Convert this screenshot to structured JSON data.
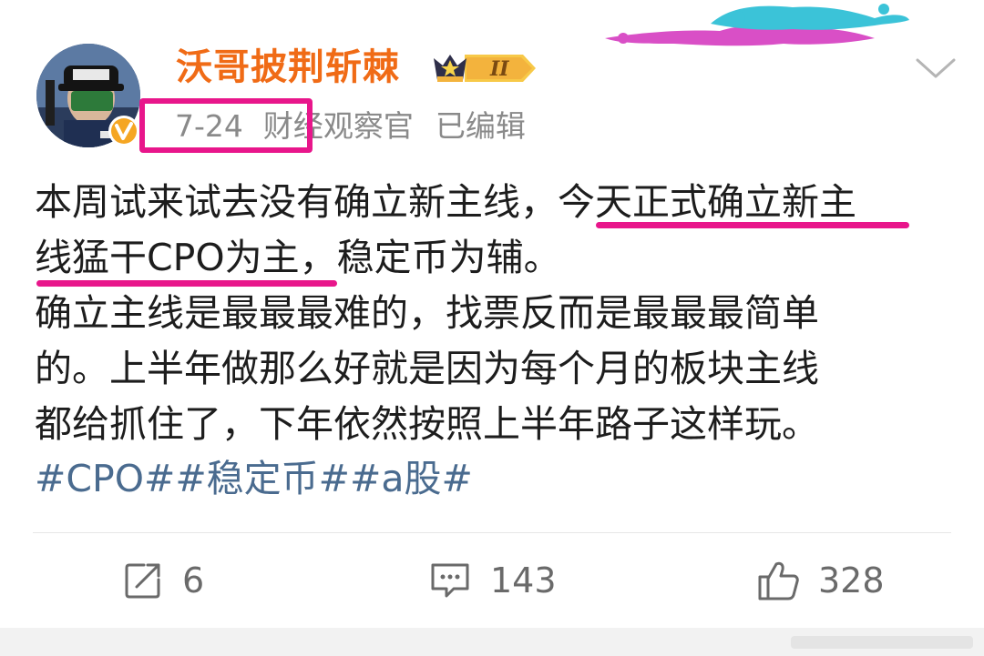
{
  "post": {
    "author": "沃哥披荆斩棘",
    "vip_level": "II",
    "date": "7-24",
    "source": "财经观察官",
    "edited": "已编辑",
    "lines": [
      "本周试来试去没有确立新主线，今天正式确立新主",
      "线猛干CPO为主，稳定币为辅。",
      "确立主线是最最最难的，找票反而是最最最简单",
      "的。上半年做那么好就是因为每个月的板块主线",
      "都给抓住了，下年依然按照上半年路子这样玩。"
    ],
    "topics": "#CPO##稳定币##a股#"
  },
  "actions": {
    "share_count": "6",
    "comment_count": "143",
    "like_count": "328"
  },
  "icons": {
    "share": "share-icon",
    "comment": "comment-icon",
    "like": "thumbs-up-icon",
    "more": "chevron-down-icon",
    "verified": "verified-v-icon",
    "vip": "crown-vip-icon"
  },
  "colors": {
    "username": "#f06b16",
    "highlight": "#e8168b",
    "topic": "#4a6b8f",
    "meta": "#8a8a8a"
  }
}
